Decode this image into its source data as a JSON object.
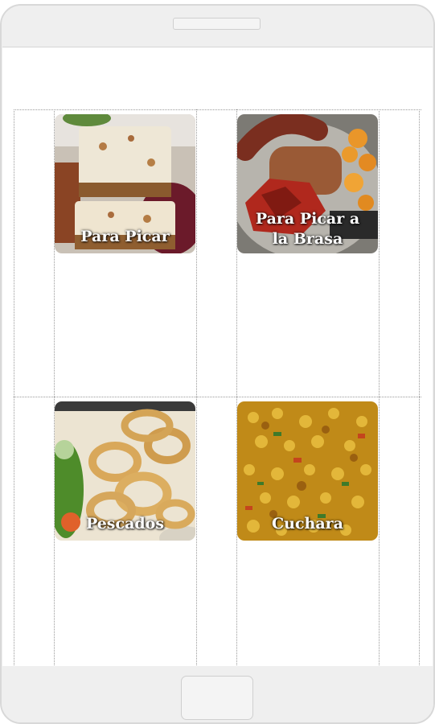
{
  "menu": {
    "tiles": [
      {
        "label": "Para Picar"
      },
      {
        "label": "Para Picar a la Brasa"
      },
      {
        "label": "Pescados"
      },
      {
        "label": "Cuchara"
      }
    ]
  },
  "colors": {
    "frame": "#efefef",
    "screen": "#ffffff",
    "label": "#ffffff",
    "gridline": "#9a9a9a"
  },
  "icons": {
    "speaker": "speaker-slot",
    "home": "home-button"
  }
}
